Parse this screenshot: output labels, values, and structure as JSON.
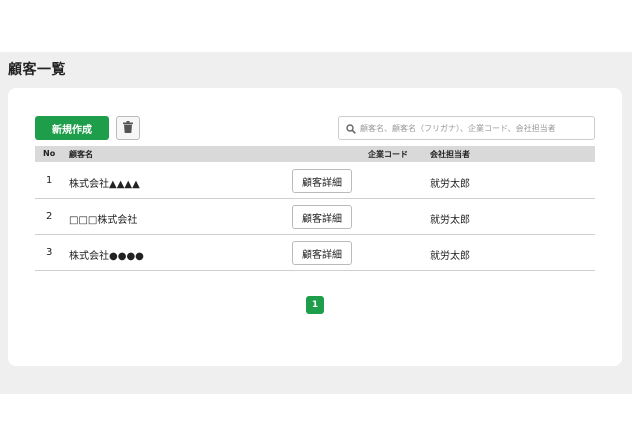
{
  "page": {
    "title": "顧客一覧"
  },
  "toolbar": {
    "new_label": "新規作成",
    "search_placeholder": "顧客名、顧客名（フリガナ）、企業コード、会社担当者"
  },
  "table": {
    "headers": {
      "no": "No",
      "name": "顧客名",
      "company_code": "企業コード",
      "staff": "会社担当者"
    },
    "rows": [
      {
        "no": "1",
        "name": "株式会社▲▲▲▲",
        "detail_label": "顧客詳細",
        "company_code": "",
        "staff": "就労太郎"
      },
      {
        "no": "2",
        "name": "□□□株式会社",
        "detail_label": "顧客詳細",
        "company_code": "",
        "staff": "就労太郎"
      },
      {
        "no": "3",
        "name": "株式会社●●●●",
        "detail_label": "顧客詳細",
        "company_code": "",
        "staff": "就労太郎"
      }
    ]
  },
  "pagination": {
    "current_page": "1"
  },
  "colors": {
    "accent": "#1e9e4a",
    "background": "#efefef",
    "header_bg": "#d9d9d9"
  },
  "icons": {
    "trash": "trash-icon",
    "search": "search-icon"
  }
}
